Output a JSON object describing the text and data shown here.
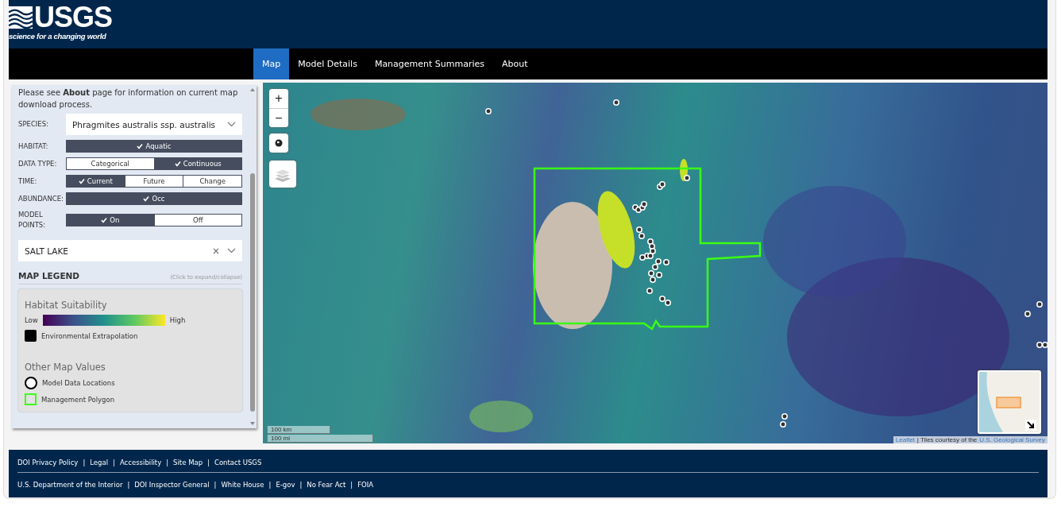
{
  "header": {
    "logo_text": "USGS",
    "tagline": "science for a changing world"
  },
  "nav": [
    {
      "label": "Map",
      "selected": true
    },
    {
      "label": "Model Details",
      "selected": false
    },
    {
      "label": "Management Summaries",
      "selected": false
    },
    {
      "label": "About",
      "selected": false
    }
  ],
  "sidebar": {
    "intro": "Please see **About** page for information on current map download process.",
    "controls": [
      {
        "kind": "select",
        "label": "SPECIES:",
        "value": "Phragmites australis ssp. australis"
      },
      {
        "kind": "toggle",
        "label": "HABITAT:",
        "options": [
          {
            "label": "Aquatic",
            "selected": true
          }
        ]
      },
      {
        "kind": "toggle",
        "label": "DATA TYPE:",
        "options": [
          {
            "label": "Categorical",
            "selected": false
          },
          {
            "label": "Continuous",
            "selected": true
          }
        ]
      },
      {
        "kind": "toggle",
        "label": "TIME:",
        "options": [
          {
            "label": "Current",
            "selected": true
          },
          {
            "label": "Future",
            "selected": false
          },
          {
            "label": "Change",
            "selected": false
          }
        ]
      },
      {
        "kind": "toggle",
        "label": "ABUNDANCE:",
        "options": [
          {
            "label": "Occ",
            "selected": true
          }
        ]
      },
      {
        "kind": "toggle",
        "label": "MODEL POINTS:",
        "options": [
          {
            "label": "On",
            "selected": true
          },
          {
            "label": "Off",
            "selected": false
          }
        ]
      }
    ],
    "location": {
      "value": "SALT LAKE"
    },
    "legend": {
      "title": "MAP LEGEND",
      "hint": "(Click to expand/collapse)",
      "suitability_title": "Habitat Suitability",
      "low": "Low",
      "high": "High",
      "extrapolation": "Environmental Extrapolation",
      "other_title": "Other Map Values",
      "items": [
        {
          "kind": "circle",
          "label": "Model Data Locations"
        },
        {
          "kind": "square",
          "label": "Management Polygon"
        }
      ]
    }
  },
  "map": {
    "zoom_in": "+",
    "zoom_out": "−",
    "scales": [
      "100 km",
      "100 mi"
    ],
    "attribution": {
      "link": "Leaflet",
      "text": "| Tiles courtesy of the",
      "source": "U.S. Geological Survey"
    }
  },
  "footer": {
    "separator": "|",
    "site_links": [
      "DOI Privacy Policy",
      "Legal",
      "Accessibility",
      "Site Map",
      "Contact USGS"
    ],
    "government_links": [
      "U.S. Department of the Interior",
      "DOI Inspector General",
      "White House",
      "E-gov",
      "No Fear Act",
      "FOIA"
    ]
  }
}
